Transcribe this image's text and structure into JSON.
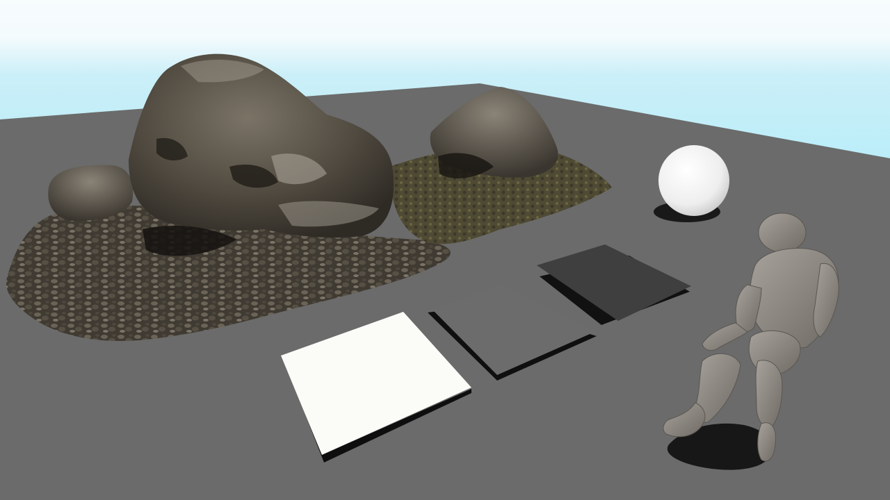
{
  "scene": {
    "type": "3d-viewport",
    "objects": [
      {
        "name": "rock-cluster",
        "material": "rock-moss"
      },
      {
        "name": "sphere",
        "material": "white"
      },
      {
        "name": "plane",
        "material": "white"
      },
      {
        "name": "plane",
        "material": "gray"
      },
      {
        "name": "plane",
        "material": "dark-gray"
      },
      {
        "name": "mannequin",
        "material": "gray"
      }
    ],
    "colors": {
      "sky_top": "#f4fbfd",
      "sky_horizon": "#bfeefa",
      "floor": "#6b6b6b",
      "rock_dark": "#3b362e",
      "rock_mid": "#5e574b",
      "rock_light": "#9b9588",
      "moss": "#5f5a36",
      "white_plane": "#fbfbf8",
      "gray_plane": "#6c6c6c",
      "dark_plane": "#3f3f3f",
      "sphere": "#f2f2f2",
      "mannequin": "#8f8a84",
      "shadow": "#0f0f0f"
    }
  }
}
